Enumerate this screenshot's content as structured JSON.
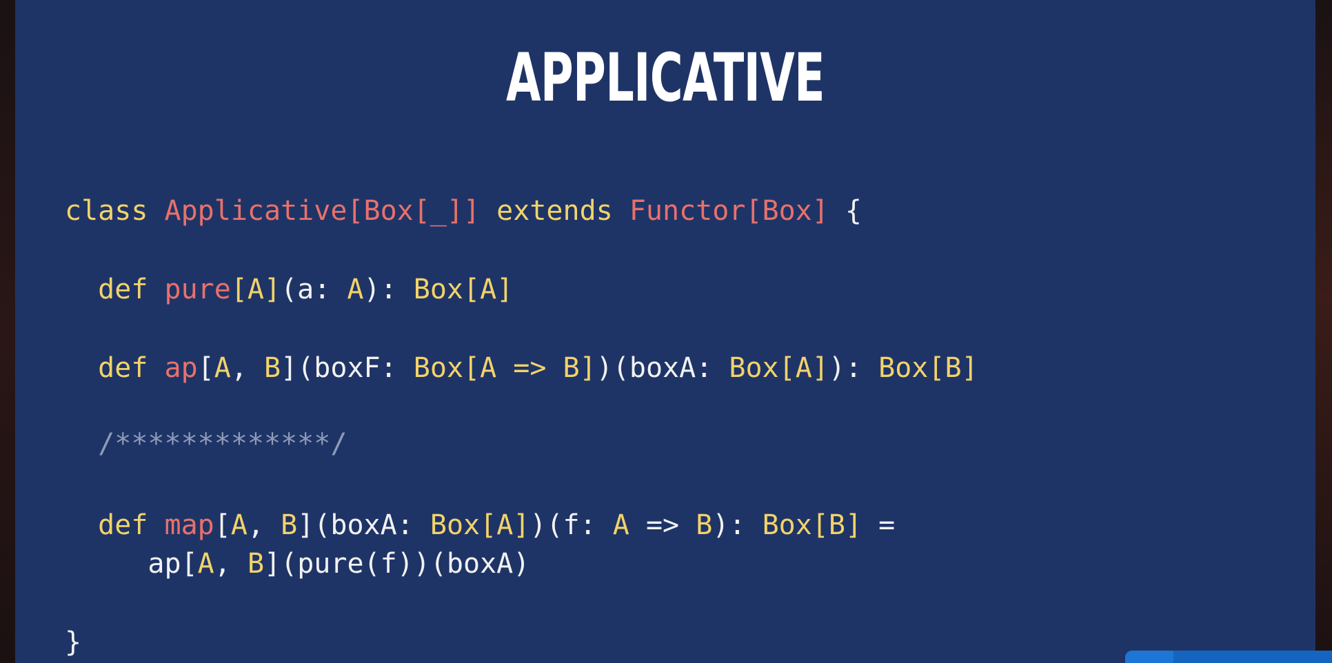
{
  "slide": {
    "title": "APPLICATIVE",
    "code": {
      "line1": {
        "kw_class": "class",
        "type_applicative": "Applicative[Box[_]]",
        "kw_extends": "extends",
        "type_functor": "Functor[Box]",
        "brace_open": "{"
      },
      "line2": {
        "kw_def": "def",
        "name": "pure",
        "tparam": "[A]",
        "args_open": "(a: ",
        "arg_type": "A",
        "args_close": "): ",
        "return_type": "Box[A]"
      },
      "line3": {
        "kw_def": "def",
        "name": "ap",
        "tparams_open": "[",
        "tp_a": "A",
        "tp_sep": ", ",
        "tp_b": "B",
        "tparams_close": "](boxF: ",
        "box_f_type": "Box[A =>",
        "space": " ",
        "box_f_b": "B]",
        "mid": ")(boxA: ",
        "box_a_type": "Box[A]",
        "close": "): ",
        "return_type": "Box[B]"
      },
      "line4": {
        "comment": "/*************/"
      },
      "line5": {
        "kw_def": "def",
        "name": "map",
        "tparams_open": "[",
        "tp_a": "A",
        "tp_sep": ", ",
        "tp_b": "B",
        "tparams_close": "](boxA: ",
        "box_a_type": "Box[A]",
        "mid": ")(f: ",
        "f_a": "A",
        "arrow": " => ",
        "f_b": "B",
        "close": "): ",
        "return_type": "Box[B]",
        "eq": " ="
      },
      "line6": {
        "prefix": "ap[",
        "tp_a": "A",
        "tp_sep": ", ",
        "tp_b": "B",
        "rest": "](pure(f))(boxA)"
      },
      "line7": {
        "brace_close": "}"
      }
    }
  },
  "colors": {
    "slide_background": "#1f3466",
    "keyword": "#f2d36b",
    "type_name": "#e8716c",
    "plain_text": "#f2f2f2",
    "comment": "#8e9bb8",
    "player_bar": "#1565c0"
  }
}
